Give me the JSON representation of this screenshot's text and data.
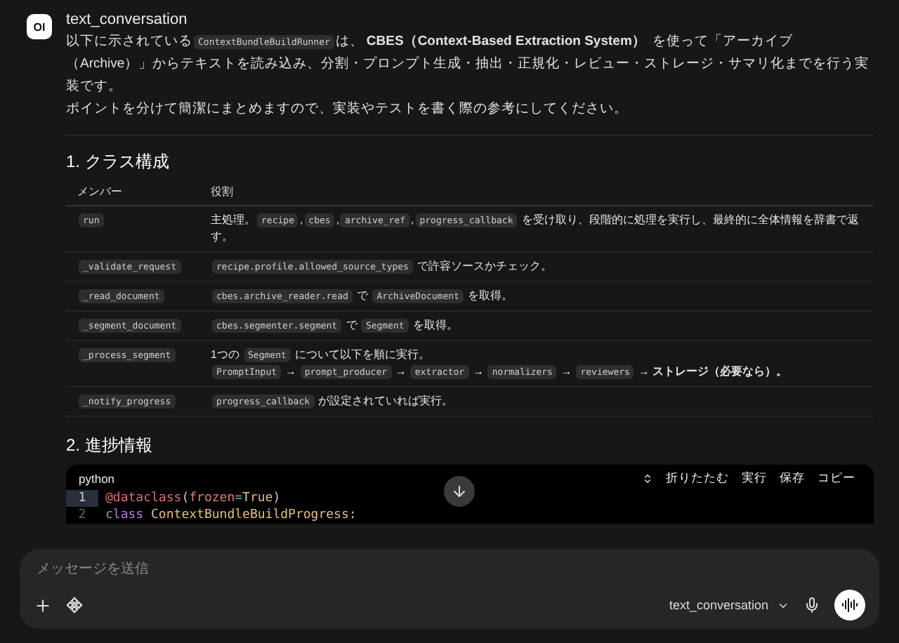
{
  "message": {
    "avatar": "OI",
    "model": "text_conversation",
    "paragraphs": [
      [
        {
          "kind": "text",
          "text": "以下に示されている"
        },
        {
          "kind": "code",
          "text": "ContextBundleBuildRunner"
        },
        {
          "kind": "text",
          "text": "は、"
        },
        {
          "kind": "bold",
          "text": "CBES（Context-Based Extraction System）"
        },
        {
          "kind": "text",
          "text": " を使って「アーカイブ（Archive）」からテキストを読み込み、分割・プロンプト生成・抽出・正規化・レビュー・ストレージ・サマリ化までを行う実装です。"
        }
      ],
      [
        {
          "kind": "text",
          "text": "ポイントを分けて簡潔にまとめますので、実装やテストを書く際の参考にしてください。"
        }
      ]
    ],
    "section1": {
      "heading": "1. クラス構成",
      "columns": [
        "メンバー",
        "役割"
      ],
      "rows": [
        {
          "member": "run",
          "role": [
            [
              {
                "kind": "text",
                "text": "主処理。"
              },
              {
                "kind": "code",
                "text": "recipe"
              },
              {
                "kind": "text",
                "text": ","
              },
              {
                "kind": "code",
                "text": "cbes"
              },
              {
                "kind": "text",
                "text": ","
              },
              {
                "kind": "code",
                "text": "archive_ref"
              },
              {
                "kind": "text",
                "text": ","
              },
              {
                "kind": "code",
                "text": "progress_callback"
              },
              {
                "kind": "text",
                "text": " を受け取り、段階的に処理を実行し、最終的に全体情報を辞書で返す。"
              }
            ]
          ]
        },
        {
          "member": "_validate_request",
          "role": [
            [
              {
                "kind": "code",
                "text": "recipe.profile.allowed_source_types"
              },
              {
                "kind": "text",
                "text": " で許容ソースかチェック。"
              }
            ]
          ]
        },
        {
          "member": "_read_document",
          "role": [
            [
              {
                "kind": "code",
                "text": "cbes.archive_reader.read"
              },
              {
                "kind": "text",
                "text": " で "
              },
              {
                "kind": "code",
                "text": "ArchiveDocument"
              },
              {
                "kind": "text",
                "text": " を取得。"
              }
            ]
          ]
        },
        {
          "member": "_segment_document",
          "role": [
            [
              {
                "kind": "code",
                "text": "cbes.segmenter.segment"
              },
              {
                "kind": "text",
                "text": " で "
              },
              {
                "kind": "code",
                "text": "Segment"
              },
              {
                "kind": "text",
                "text": " を取得。"
              }
            ]
          ]
        },
        {
          "member": "_process_segment",
          "role": [
            [
              {
                "kind": "text",
                "text": "1つの "
              },
              {
                "kind": "code",
                "text": "Segment"
              },
              {
                "kind": "text",
                "text": " について以下を順に実行。"
              }
            ],
            [
              {
                "kind": "code",
                "text": "PromptInput"
              },
              {
                "kind": "bold",
                "text": "→"
              },
              {
                "kind": "code",
                "text": "prompt_producer"
              },
              {
                "kind": "bold",
                "text": "→"
              },
              {
                "kind": "code",
                "text": "extractor"
              },
              {
                "kind": "bold",
                "text": "→"
              },
              {
                "kind": "code",
                "text": "normalizers"
              },
              {
                "kind": "bold",
                "text": "→"
              },
              {
                "kind": "code",
                "text": "reviewers"
              },
              {
                "kind": "bold",
                "text": "→ ストレージ（必要なら）。"
              }
            ]
          ]
        },
        {
          "member": "_notify_progress",
          "role": [
            [
              {
                "kind": "code",
                "text": "progress_callback"
              },
              {
                "kind": "text",
                "text": " が設定されていれば実行。"
              }
            ]
          ]
        }
      ]
    },
    "section2": {
      "heading": "2. 進捗情報",
      "code": {
        "language": "python",
        "actions": [
          "折りたたむ",
          "実行",
          "保存",
          "コピー"
        ],
        "lines": [
          {
            "number": "1",
            "selected": true,
            "tokens": [
              {
                "kind": "decorator",
                "text": "@dataclass"
              },
              {
                "kind": "punct",
                "text": "("
              },
              {
                "kind": "param",
                "text": "frozen"
              },
              {
                "kind": "op",
                "text": "="
              },
              {
                "kind": "const",
                "text": "True"
              },
              {
                "kind": "punct",
                "text": ")"
              }
            ]
          },
          {
            "number": "2",
            "selected": false,
            "tokens": [
              {
                "kind": "keyword",
                "text": "class "
              },
              {
                "kind": "name",
                "text": "ContextBundleBuildProgress"
              },
              {
                "kind": "punct",
                "text": ":"
              }
            ]
          }
        ]
      }
    }
  },
  "composer": {
    "placeholder": "メッセージを送信",
    "model": "text_conversation"
  }
}
